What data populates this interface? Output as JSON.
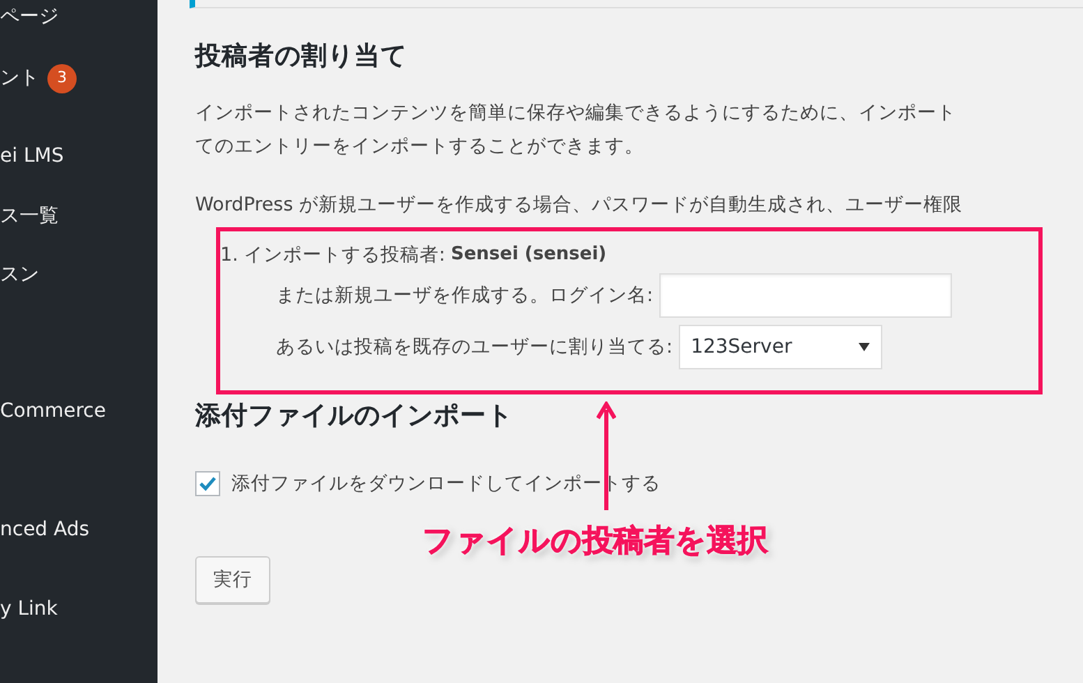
{
  "sidebar": {
    "items": [
      {
        "label": "ページ"
      },
      {
        "label": "ント",
        "badge": "3"
      },
      {
        "label": "ei LMS"
      },
      {
        "label": "ス一覧"
      },
      {
        "label": "スン"
      },
      {
        "label": "Commerce"
      },
      {
        "label": "nced Ads"
      },
      {
        "label": "y Link"
      }
    ]
  },
  "author_section": {
    "title": "投稿者の割り当て",
    "description_lines": [
      "インポートされたコンテンツを簡単に保存や編集できるようにするために、インポート",
      "てのエントリーをインポートすることができます。"
    ],
    "note": "WordPress が新規ユーザーを作成する場合、パスワードが自動生成され、ユーザー権限",
    "author_item": {
      "number": "1.",
      "label": "インポートする投稿者:",
      "author": "Sensei (sensei)",
      "new_user_label": "または新規ユーザを作成する。ログイン名:",
      "existing_user_label": "あるいは投稿を既存のユーザーに割り当てる:",
      "existing_user_value": "123Server"
    }
  },
  "attachments_section": {
    "title": "添付ファイルのインポート",
    "checkbox_label": "添付ファイルをダウンロードしてインポートする",
    "checked": true
  },
  "submit_button": "実行",
  "annotation": {
    "callout": "ファイルの投稿者を選択"
  }
}
